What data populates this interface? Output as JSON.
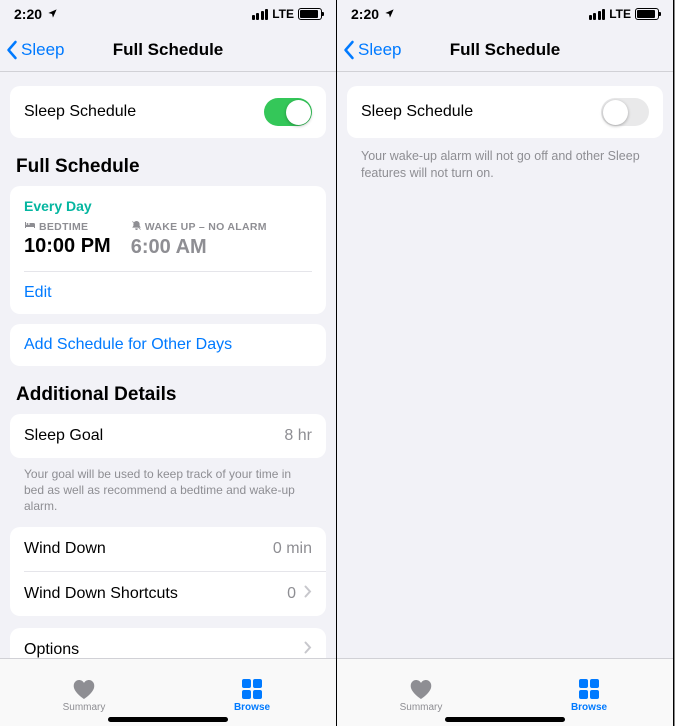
{
  "status": {
    "time": "2:20",
    "net": "LTE"
  },
  "nav": {
    "back": "Sleep",
    "title": "Full Schedule"
  },
  "left": {
    "sleep_schedule_label": "Sleep Schedule",
    "full_schedule_heading": "Full Schedule",
    "every_day": "Every Day",
    "bedtime_label": "BEDTIME",
    "bedtime_value": "10:00 PM",
    "wakeup_label": "WAKE UP – NO ALARM",
    "wakeup_value": "6:00 AM",
    "edit": "Edit",
    "add_schedule": "Add Schedule for Other Days",
    "additional_heading": "Additional Details",
    "sleep_goal_label": "Sleep Goal",
    "sleep_goal_value": "8 hr",
    "sleep_goal_note": "Your goal will be used to keep track of your time in bed as well as recommend a bedtime and wake-up alarm.",
    "wind_down_label": "Wind Down",
    "wind_down_value": "0 min",
    "wind_down_shortcuts_label": "Wind Down Shortcuts",
    "wind_down_shortcuts_value": "0",
    "options_label": "Options"
  },
  "right": {
    "sleep_schedule_label": "Sleep Schedule",
    "disabled_note": "Your wake-up alarm will not go off and other Sleep features will not turn on."
  },
  "tabs": {
    "summary": "Summary",
    "browse": "Browse"
  }
}
